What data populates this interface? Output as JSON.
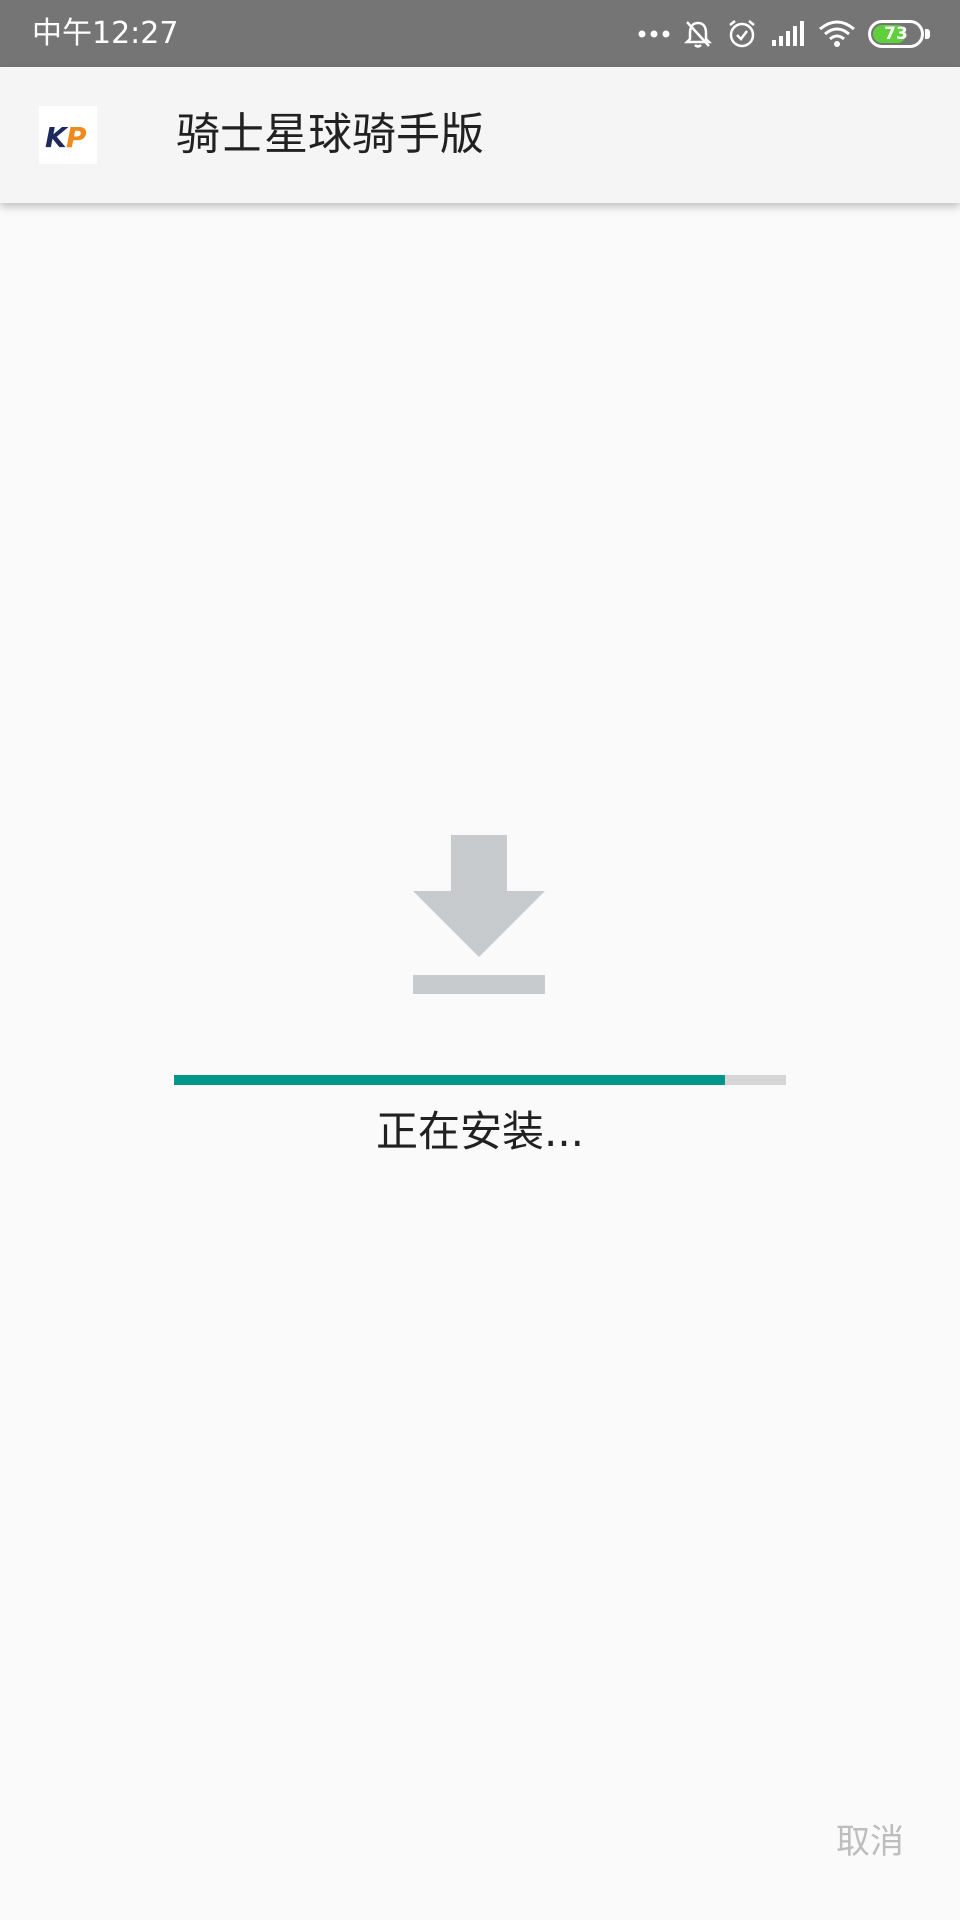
{
  "status_bar": {
    "time": "中午12:27",
    "battery_level": "73",
    "icons": [
      "more-dots-icon",
      "bell-muted-icon",
      "alarm-icon",
      "signal-icon",
      "wifi-icon",
      "battery-icon"
    ],
    "battery_color": "#5fd03b"
  },
  "app_bar": {
    "title": "骑士星球骑手版",
    "icon": "app-logo-icon",
    "logo_text": "KP"
  },
  "main": {
    "icon": "download-icon",
    "progress": 0.9,
    "status": "正在安装..."
  },
  "footer": {
    "cancel_label": "取消"
  },
  "colors": {
    "status_bar": "#757575",
    "app_bar": "#f5f5f5",
    "background": "#fafafa",
    "accent": "#009688",
    "progress_track": "#d6d6d6",
    "icon_gray": "#c8cbce",
    "disabled_text": "#bdbdbd"
  }
}
